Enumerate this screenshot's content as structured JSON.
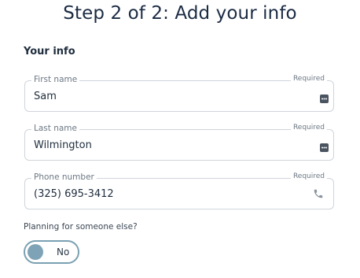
{
  "page": {
    "title": "Step 2 of 2: Add your info"
  },
  "section": {
    "title": "Your info"
  },
  "fields": {
    "first_name": {
      "label": "First name",
      "required": "Required",
      "value": "Sam",
      "icon": "autofill-dots-icon"
    },
    "last_name": {
      "label": "Last name",
      "required": "Required",
      "value": "Wilmington",
      "icon": "autofill-dots-icon"
    },
    "phone": {
      "label": "Phone number",
      "required": "Required",
      "value": "(325) 695-3412",
      "icon": "phone-icon"
    }
  },
  "planning": {
    "question": "Planning for someone else?",
    "toggle_label": "No",
    "toggle_on": false
  },
  "colors": {
    "title": "#1b2b43",
    "border": "#cfd5db",
    "toggle_accent": "#7aa0b2"
  }
}
